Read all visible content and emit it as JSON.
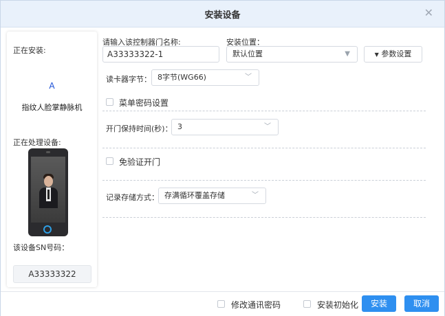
{
  "dialog": {
    "title": "安装设备",
    "close_icon": "close-icon"
  },
  "left_panel": {
    "installing_label": "正在安装:",
    "device_letter": "A",
    "device_name": "指纹人脸掌静脉机",
    "processing_label": "正在处理设备:",
    "sn_label": "该设备SN号码：",
    "sn_value": "A33333322"
  },
  "form": {
    "door_name_label": "请输入该控制器门名称:",
    "door_name_value": "A33333322-1",
    "location_label": "安装位置：",
    "location_value": "默认位置",
    "param_button": "参数设置",
    "param_icon": "caret-down-icon",
    "reader_bytes_label": "读卡器字节：",
    "reader_bytes_value": "8字节(WG66)",
    "menu_password_label": "菜单密码设置",
    "door_hold_label": "开门保持时间(秒)：",
    "door_hold_value": "3",
    "no_verify_label": "免验证开门",
    "record_storage_label": "记录存储方式：",
    "record_storage_value": "存满循环覆盖存储"
  },
  "footer": {
    "modify_comm_password": "修改通讯密码",
    "install_init": "安装初始化",
    "install_button": "安装",
    "cancel_button": "取消"
  },
  "colors": {
    "primary": "#2e8ff0",
    "titlebar": "#e9f1fb",
    "device_letter": "#1a4fd6"
  }
}
